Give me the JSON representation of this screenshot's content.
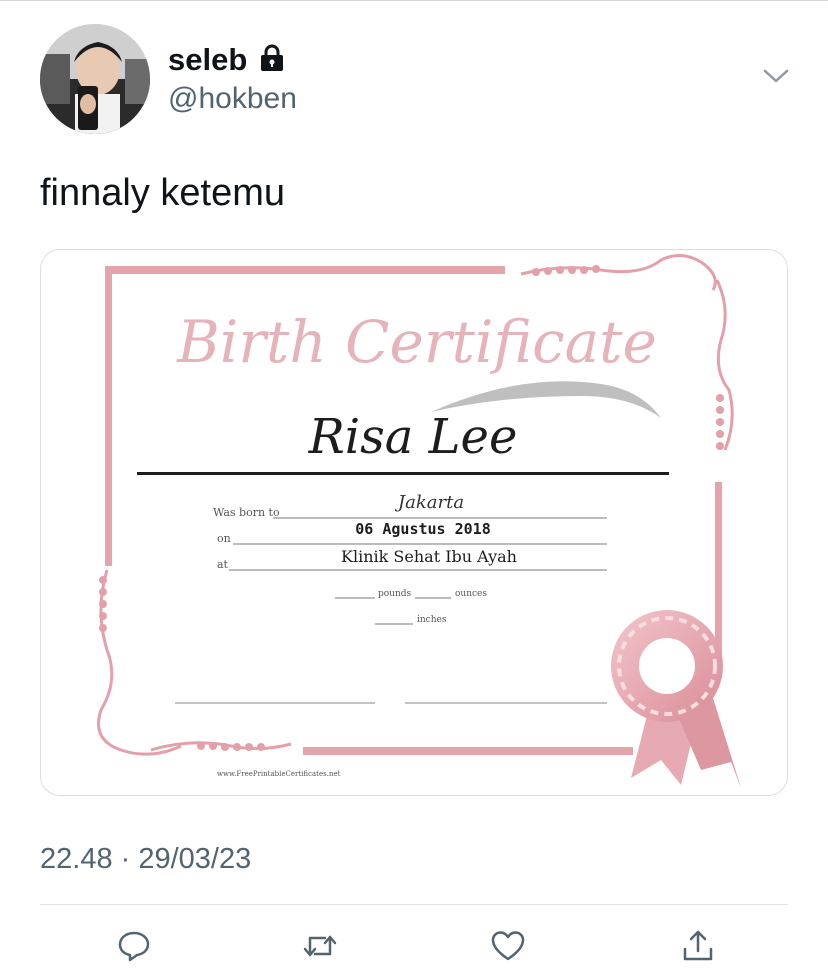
{
  "user": {
    "display_name": "seleb",
    "handle": "@hokben",
    "protected_icon": "lock-icon",
    "avatar_icon": "avatar-photo"
  },
  "tweet": {
    "text": "finnaly ketemu",
    "timestamp": "22.48 · 29/03/23",
    "menu_icon": "chevron-down-icon"
  },
  "certificate": {
    "title": "Birth Certificate",
    "name": "Risa Lee",
    "born_label": "Was born to",
    "born_value": "Jakarta",
    "on_label": "on",
    "on_value": "06 Agustus 2018",
    "at_label": "at",
    "at_value": "Klinik Sehat Ibu Ayah",
    "pounds_label": "pounds",
    "ounces_label": "ounces",
    "inches_label": "inches",
    "footer_url": "www.FreePrintableCertificates.net"
  },
  "actions": [
    {
      "icon": "reply-icon"
    },
    {
      "icon": "retweet-icon"
    },
    {
      "icon": "like-icon"
    },
    {
      "icon": "share-icon"
    }
  ],
  "colors": {
    "accent_pink": "#e5a3ab",
    "text_primary": "#0f1419",
    "text_secondary": "#536471"
  }
}
